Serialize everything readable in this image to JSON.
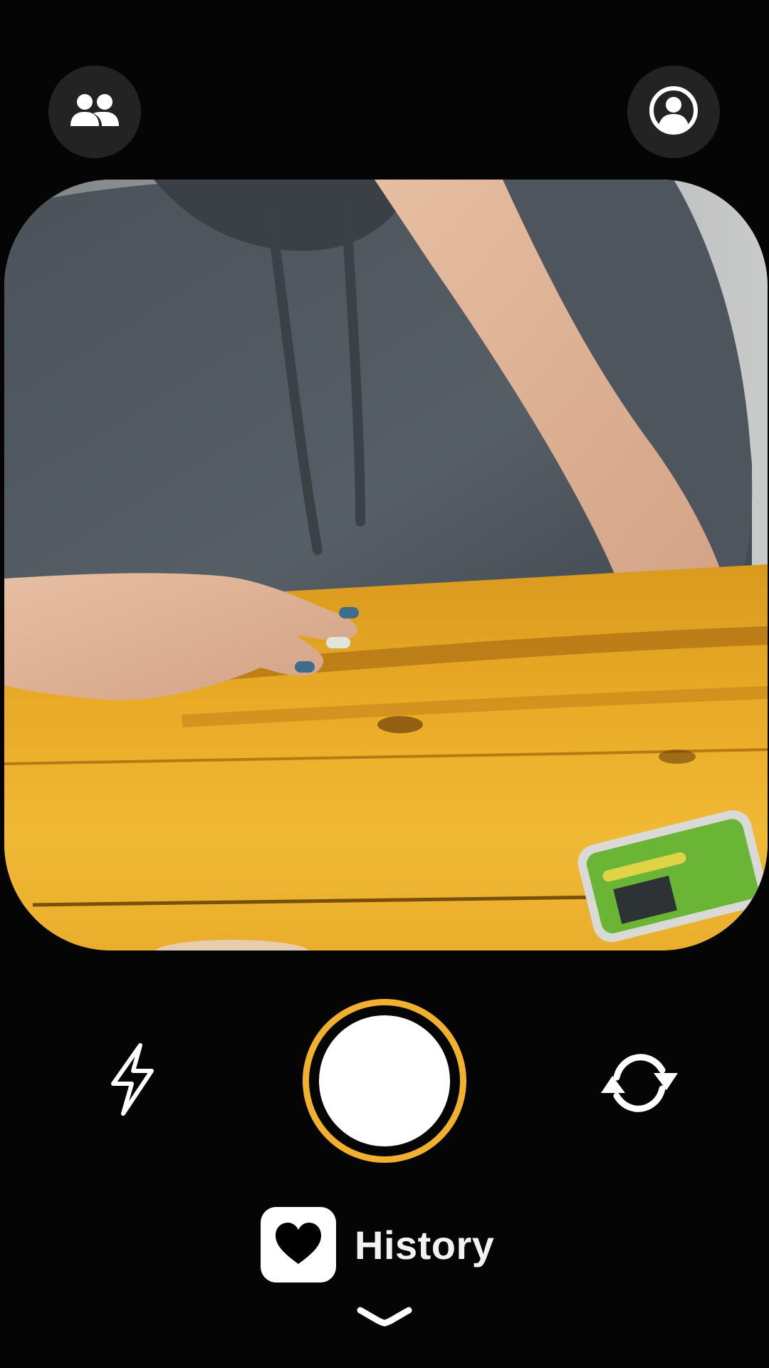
{
  "icons": {
    "friends": "friends-icon",
    "profile": "profile-icon",
    "flash": "flash-icon",
    "flip_camera": "flip-camera-icon",
    "history_heart": "heart-icon",
    "expand": "chevron-down-icon"
  },
  "colors": {
    "background": "#050505",
    "top_button": "#232323",
    "shutter_ring": "#f1b02d",
    "shutter_fill": "#ffffff",
    "icon": "#ffffff"
  },
  "history": {
    "label": "History"
  }
}
